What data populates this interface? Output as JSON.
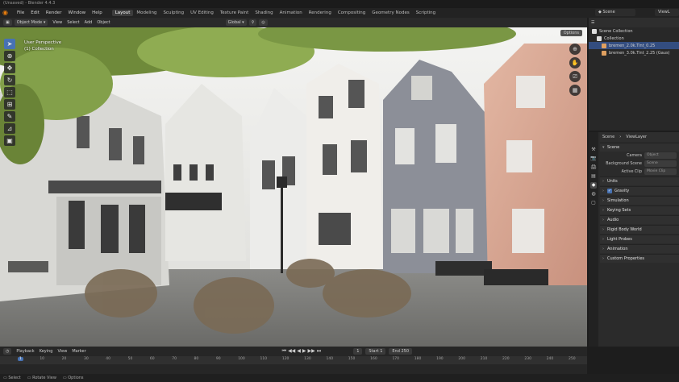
{
  "window": {
    "title": "(Unsaved) - Blender 4.4.3"
  },
  "menus": [
    "File",
    "Edit",
    "Render",
    "Window",
    "Help"
  ],
  "workspaces": [
    {
      "label": "Layout",
      "active": true
    },
    {
      "label": "Modeling"
    },
    {
      "label": "Sculpting"
    },
    {
      "label": "UV Editing"
    },
    {
      "label": "Texture Paint"
    },
    {
      "label": "Shading"
    },
    {
      "label": "Animation"
    },
    {
      "label": "Rendering"
    },
    {
      "label": "Compositing"
    },
    {
      "label": "Geometry Nodes"
    },
    {
      "label": "Scripting"
    }
  ],
  "top_right": {
    "scene": "Scene",
    "view_layer": "ViewL"
  },
  "viewport_header": {
    "mode": "Object Mode",
    "view": "View",
    "select": "Select",
    "add": "Add",
    "object": "Object",
    "transform": "Global",
    "options": "Options"
  },
  "viewport_overlay": {
    "perspective": "User Perspective",
    "collection": "(1) Collection"
  },
  "outliner": {
    "header": "Scene Collection",
    "rows": [
      {
        "label": "Scene Collection",
        "color": "#dddddd"
      },
      {
        "label": "Collection",
        "color": "#dddddd"
      },
      {
        "label": "bremen_2.0k.Tint_0.25",
        "selected": true,
        "color": "#e0a060"
      },
      {
        "label": "bremen_3.0k.Tint_2.25 (Gaus)",
        "color": "#e0a060"
      }
    ]
  },
  "properties": {
    "breadcrumb_scene": "Scene",
    "breadcrumb_layer": "ViewLayer",
    "scene_panel": "Scene",
    "fields": [
      {
        "label": "Camera",
        "value": "Object"
      },
      {
        "label": "Background Scene",
        "value": "Scene"
      },
      {
        "label": "Active Clip",
        "value": "Movie Clip"
      }
    ],
    "panels": [
      {
        "label": "Units"
      },
      {
        "label": "Gravity",
        "checkbox": true
      },
      {
        "label": "Simulation"
      },
      {
        "label": "Keying Sets"
      },
      {
        "label": "Audio"
      },
      {
        "label": "Rigid Body World"
      },
      {
        "label": "Light Probes"
      },
      {
        "label": "Animation"
      },
      {
        "label": "Custom Properties"
      }
    ]
  },
  "timeline": {
    "playback": "Playback",
    "keying": "Keying",
    "view": "View",
    "marker": "Marker",
    "current_frame": "1",
    "start_label": "Start",
    "start": "1",
    "end_label": "End",
    "end": "250",
    "ticks": [
      "1",
      "10",
      "20",
      "30",
      "40",
      "50",
      "60",
      "70",
      "80",
      "90",
      "100",
      "110",
      "120",
      "130",
      "140",
      "150",
      "160",
      "170",
      "180",
      "190",
      "200",
      "210",
      "220",
      "230",
      "240",
      "250"
    ]
  },
  "statusbar": {
    "select": "Select",
    "rotate": "Rotate View",
    "options": "Options"
  },
  "colors": {
    "accent": "#4772b3",
    "selection": "#334d80",
    "brand": "#e87d0d"
  }
}
